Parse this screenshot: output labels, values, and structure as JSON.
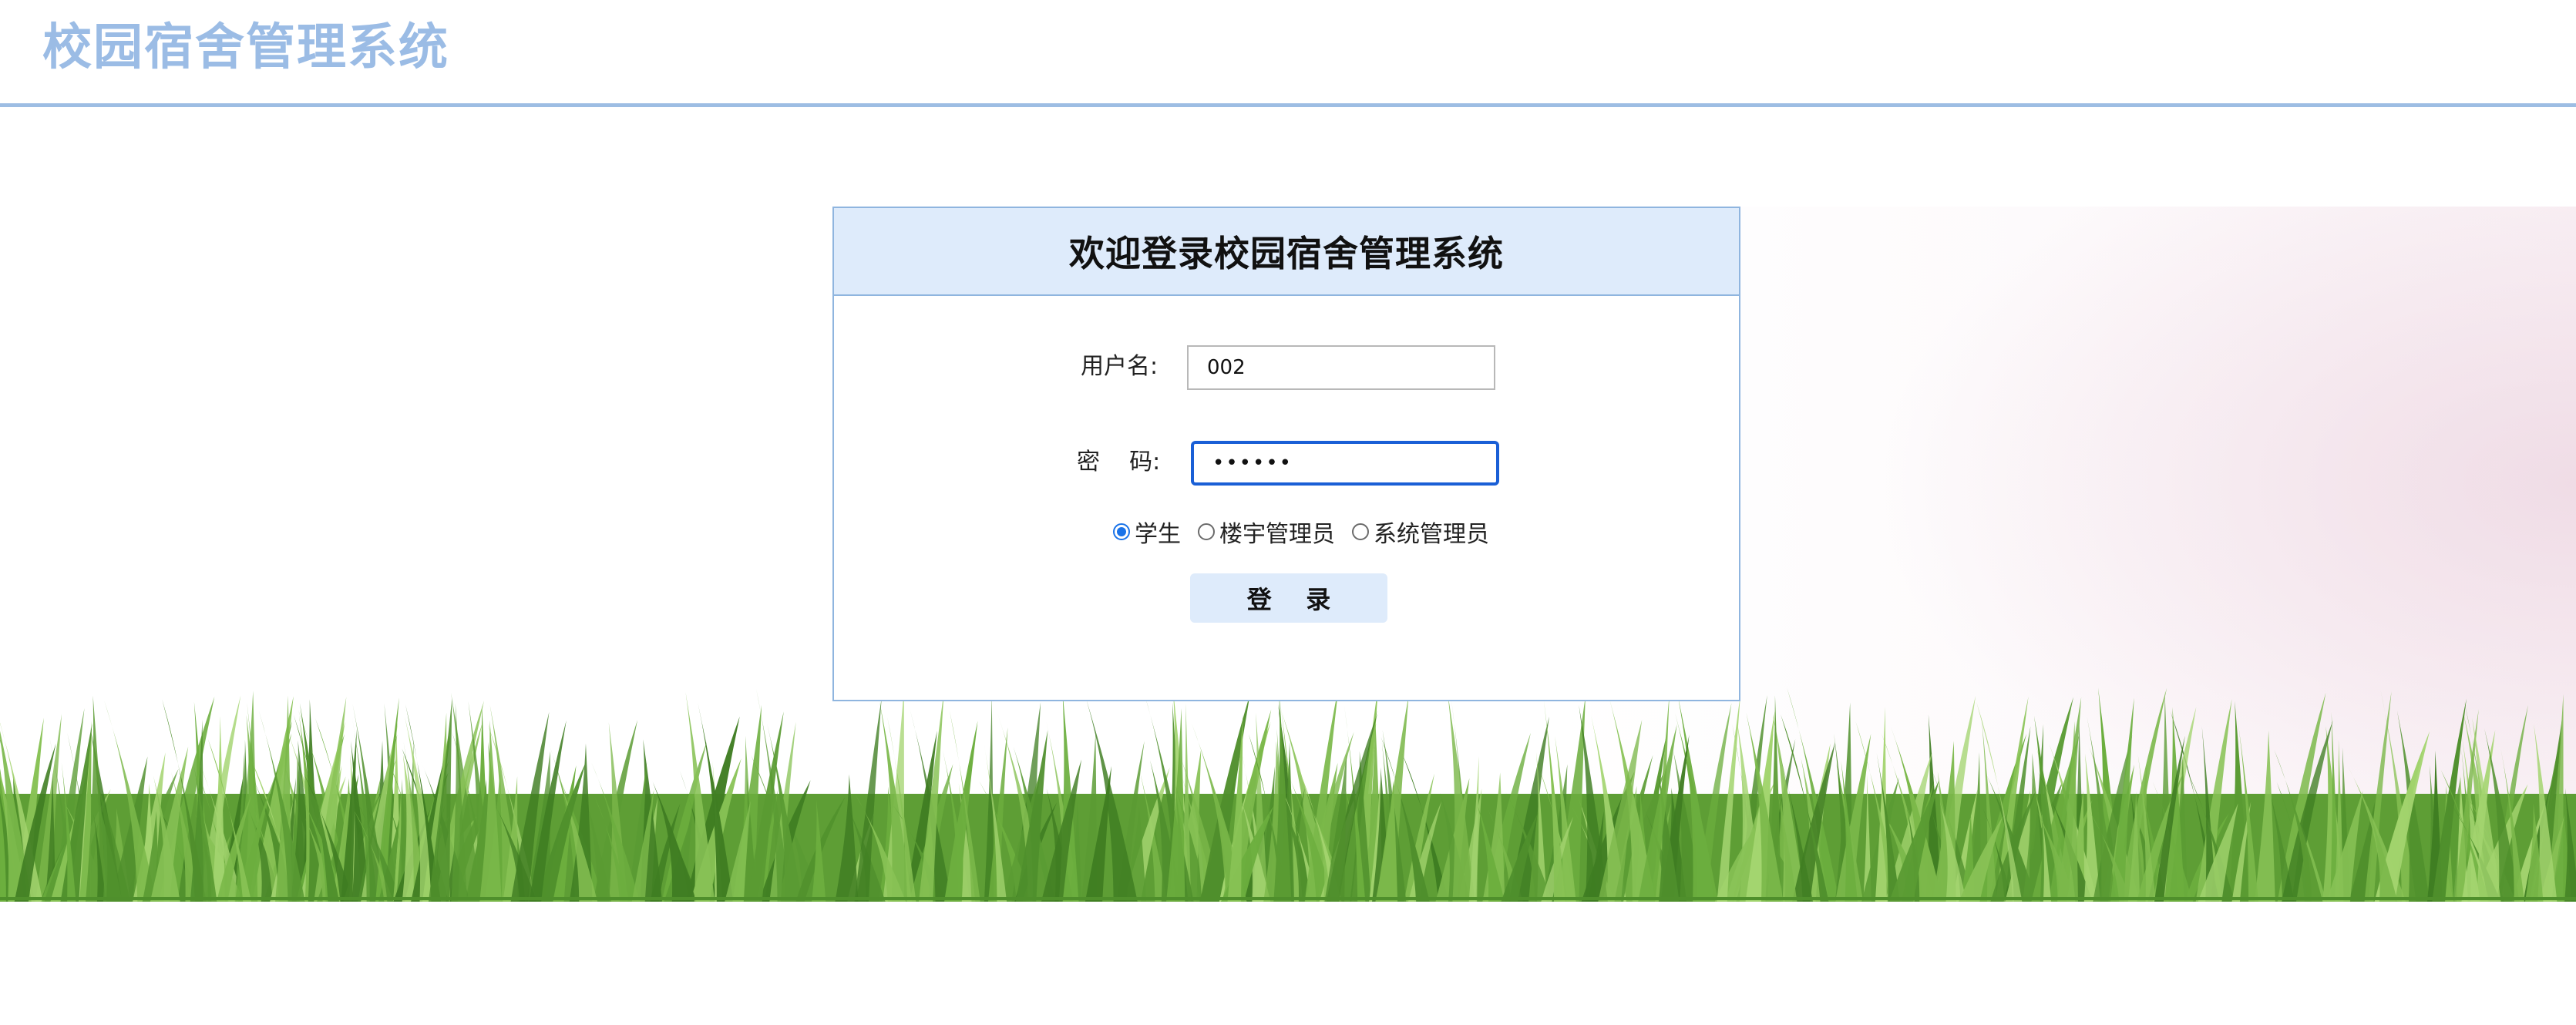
{
  "header": {
    "site_title": "校园宿舍管理系统"
  },
  "login": {
    "panel_title": "欢迎登录校园宿舍管理系统",
    "username_label": "用户名:",
    "username_value": "002",
    "password_label": "密    码:",
    "password_value": "••••••",
    "roles": [
      {
        "label": "学生",
        "checked": true
      },
      {
        "label": "楼宇管理员",
        "checked": false
      },
      {
        "label": "系统管理员",
        "checked": false
      }
    ],
    "submit_label": "登    录"
  },
  "colors": {
    "title_color": "#9bbce5",
    "header_rule": "#9dbde3",
    "panel_header_bg": "#deebfb",
    "panel_border": "#8fb5df",
    "focus_border": "#1a5fd6",
    "grass": "#6cae3e"
  }
}
